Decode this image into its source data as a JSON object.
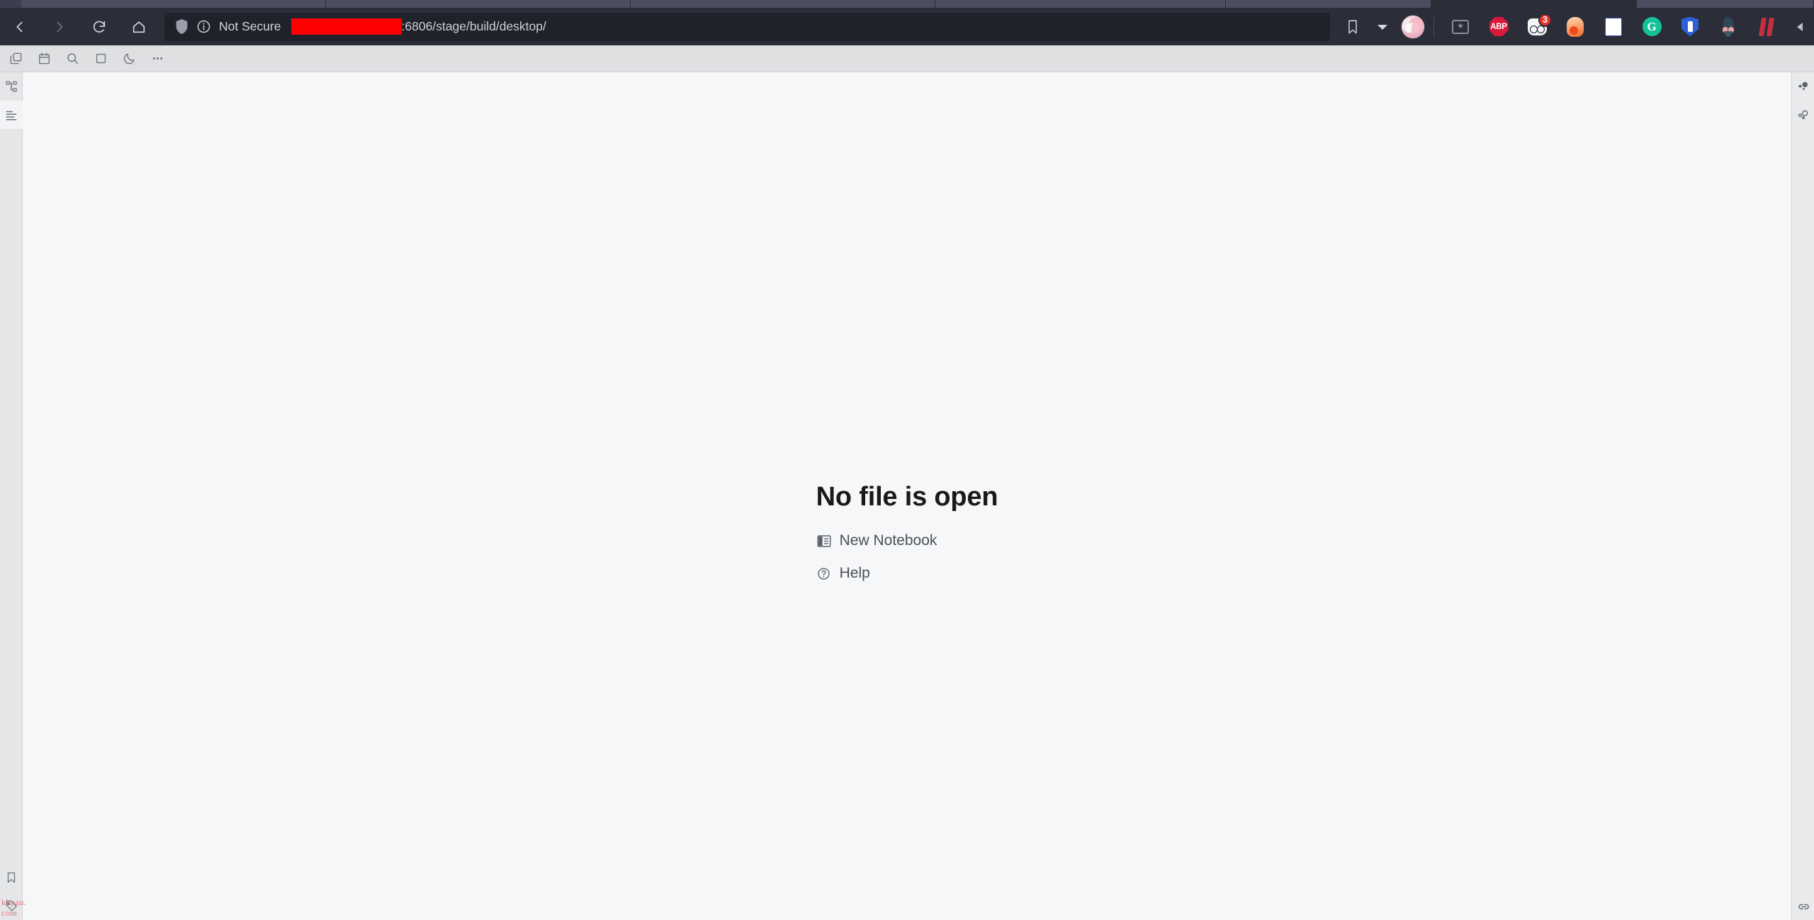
{
  "browser": {
    "nav": {
      "back": "back-arrow",
      "forward": "forward-arrow",
      "reload": "reload-arrow",
      "home": "home-house"
    },
    "omnibox": {
      "security_label": "Not Secure",
      "url_redacted": true,
      "url_text": ":6806/stage/build/desktop/",
      "shield_icon": "shield-icon",
      "info_icon": "info-circle-icon"
    },
    "actions": {
      "bookmark": "bookmark-ribbon-icon",
      "bookmark_dropdown": "caret-down-icon",
      "profile": "profile-avatar",
      "collapse": "chevron-left-icon"
    },
    "extensions": [
      {
        "name": "image-capture-extension",
        "glyph": "img-tool",
        "badge": ""
      },
      {
        "name": "adblock-plus-extension",
        "glyph": "abp",
        "label": "ABP",
        "badge": ""
      },
      {
        "name": "goggles-extension",
        "glyph": "goggles",
        "badge": "3"
      },
      {
        "name": "blob-extension",
        "glyph": "blob",
        "badge": ""
      },
      {
        "name": "document-extension",
        "glyph": "doc",
        "badge": ""
      },
      {
        "name": "grammarly-extension",
        "glyph": "grammarly",
        "label": "G",
        "badge": ""
      },
      {
        "name": "security-shield-extension",
        "glyph": "shield-blue",
        "badge": ""
      },
      {
        "name": "rocket-extension",
        "glyph": "rocket",
        "badge": ""
      },
      {
        "name": "pause-extension",
        "glyph": "pause",
        "badge": ""
      }
    ]
  },
  "app": {
    "toolbar": [
      {
        "name": "duplicate-icon",
        "glyph": "duplicate"
      },
      {
        "name": "calendar-icon",
        "glyph": "calendar"
      },
      {
        "name": "search-icon",
        "glyph": "search"
      },
      {
        "name": "square-icon",
        "glyph": "square"
      },
      {
        "name": "dark-mode-moon-icon",
        "glyph": "moon"
      },
      {
        "name": "more-options-icon",
        "glyph": "ellipsis"
      }
    ],
    "left_rail_top": [
      {
        "name": "sidebar-item-hierarchy",
        "glyph": "hierarchy",
        "active": false
      },
      {
        "name": "sidebar-item-outline",
        "glyph": "outline",
        "active": true
      }
    ],
    "left_rail_bottom": [
      {
        "name": "sidebar-item-bookmarks",
        "glyph": "bookmark",
        "active": false
      },
      {
        "name": "sidebar-item-tags",
        "glyph": "tag",
        "active": false
      }
    ],
    "right_rail_top": [
      {
        "name": "sidebar-item-graph-filled",
        "glyph": "graph-filled",
        "active": false
      },
      {
        "name": "sidebar-item-graph-outline",
        "glyph": "graph-outline",
        "active": false
      }
    ],
    "right_rail_bottom": [
      {
        "name": "sidebar-item-backlinks",
        "glyph": "link",
        "active": false
      }
    ],
    "empty_state": {
      "title": "No file is open",
      "links": [
        {
          "label": "New Notebook",
          "icon": "notebook-icon"
        },
        {
          "label": "Help",
          "icon": "help-circle-icon"
        }
      ]
    }
  },
  "watermark": {
    "text": "kkpan. com"
  }
}
